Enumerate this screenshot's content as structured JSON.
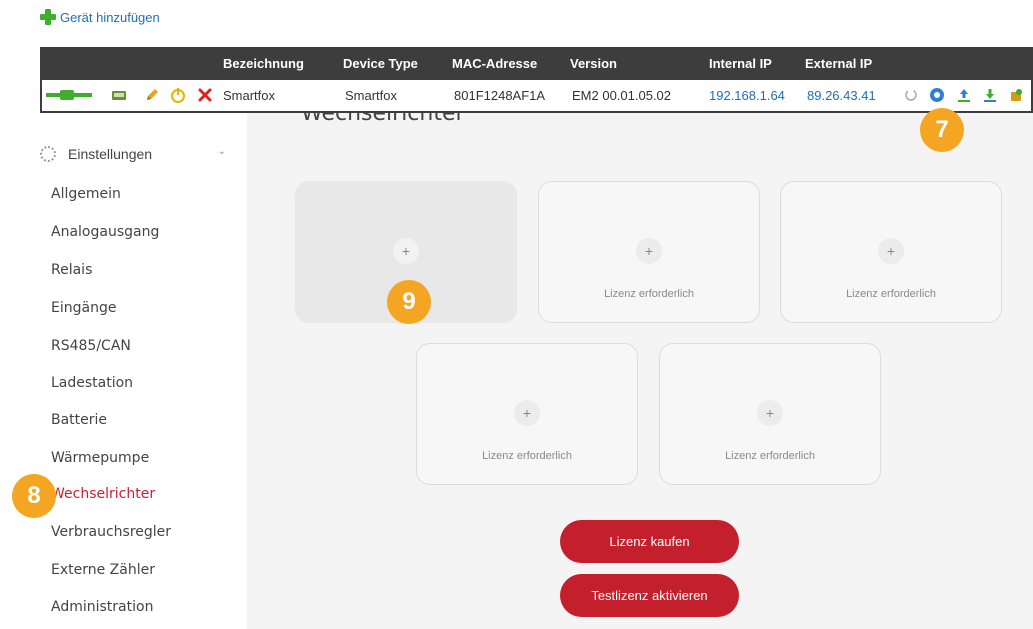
{
  "add_device": {
    "label": "Gerät hinzufügen"
  },
  "device_table": {
    "headers": [
      "Bezeichnung",
      "Device Type",
      "MAC-Adresse",
      "Version",
      "Internal IP",
      "External IP"
    ],
    "row": {
      "name": "Smartfox",
      "device_type": "Smartfox",
      "mac": "801F1248AF1A",
      "version": "EM2 00.01.05.02",
      "internal_ip": "192.168.1.64",
      "external_ip": "89.26.43.41"
    },
    "row_icons": [
      "plug-icon",
      "device-icon",
      "edit-icon",
      "power-icon",
      "delete-icon",
      "refresh-icon",
      "settings-icon",
      "upload-icon",
      "download-icon",
      "update-icon"
    ]
  },
  "sidebar": {
    "settings_label": "Einstellungen",
    "items": [
      {
        "label": "Allgemein"
      },
      {
        "label": "Analogausgang"
      },
      {
        "label": "Relais"
      },
      {
        "label": "Eingänge"
      },
      {
        "label": "RS485/CAN"
      },
      {
        "label": "Ladestation"
      },
      {
        "label": "Batterie"
      },
      {
        "label": "Wärmepumpe"
      },
      {
        "label": "Wechselrichter"
      },
      {
        "label": "Verbrauchsregler"
      },
      {
        "label": "Externe Zähler"
      },
      {
        "label": "Administration"
      }
    ],
    "active_item": "Wechselrichter"
  },
  "main": {
    "title": "Wechselrichter",
    "cards": [
      {
        "plus": "+",
        "text": ""
      },
      {
        "plus": "+",
        "text": "Lizenz erforderlich"
      },
      {
        "plus": "+",
        "text": "Lizenz erforderlich"
      },
      {
        "plus": "+",
        "text": "Lizenz erforderlich"
      },
      {
        "plus": "+",
        "text": "Lizenz erforderlich"
      }
    ],
    "buy_license": "Lizenz kaufen",
    "trial_license": "Testlizenz aktivieren"
  },
  "callouts": {
    "c7": "7",
    "c8": "8",
    "c9": "9"
  },
  "colors": {
    "accent_red": "#c41f2d",
    "link_blue": "#1f6fb5",
    "callout_orange": "#f4a623",
    "header_dark": "#3d3d3d",
    "green": "#3fae2a"
  }
}
